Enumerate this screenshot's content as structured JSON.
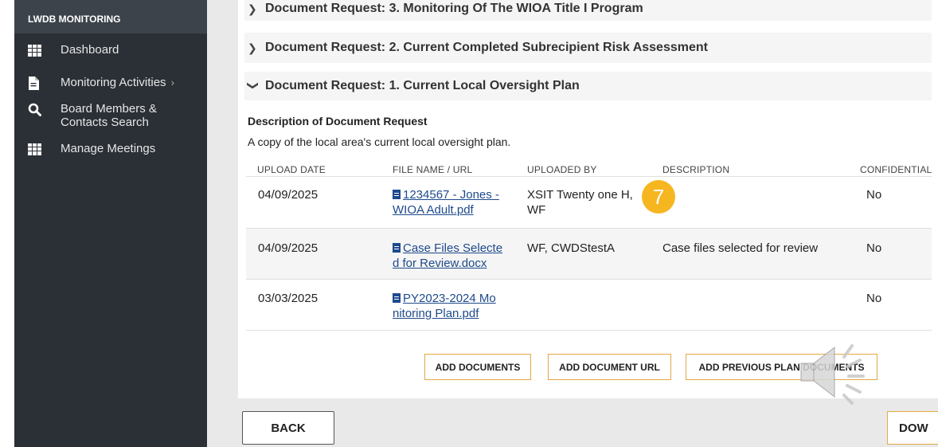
{
  "sidebar": {
    "title": "LWDB MONITORING",
    "items": [
      {
        "label": "Dashboard",
        "icon": "grid-icon"
      },
      {
        "label": "Monitoring Activities",
        "icon": "document-icon",
        "chevron": "›"
      },
      {
        "label": "Board Members & Contacts Search",
        "icon": "search-icon"
      },
      {
        "label": "Manage Meetings",
        "icon": "grid-icon"
      }
    ]
  },
  "accordion": {
    "items": [
      {
        "label": "Document Request: 3. Monitoring Of The WIOA Title I Program",
        "state": "collapsed"
      },
      {
        "label": "Document Request: 2. Current Completed Subrecipient Risk Assessment",
        "state": "collapsed"
      },
      {
        "label": "Document Request: 1. Current Local Oversight Plan",
        "state": "expanded"
      }
    ]
  },
  "request": {
    "desc_title": "Description of Document Request",
    "desc_text": "A copy of the local area's current local oversight plan."
  },
  "table": {
    "headers": [
      "UPLOAD DATE",
      "FILE NAME / URL",
      "UPLOADED BY",
      "DESCRIPTION",
      "CONFIDENTIAL"
    ],
    "rows": [
      {
        "date": "04/09/2025",
        "file_line1": "1234567 - Jones -",
        "file_line2": "WIOA Adult.pdf",
        "by_line1": "XSIT Twenty one H,",
        "by_line2": "WF",
        "description": "",
        "confidential": "No"
      },
      {
        "date": "04/09/2025",
        "file_line1": "Case Files Selecte",
        "file_line2": "d for Review.docx",
        "by_line1": "WF, CWDStestA",
        "by_line2": "",
        "description": "Case files selected for review",
        "confidential": "No"
      },
      {
        "date": "03/03/2025",
        "file_line1": "PY2023-2024 Mo",
        "file_line2": "nitoring Plan.pdf",
        "by_line1": "",
        "by_line2": "",
        "description": "",
        "confidential": "No"
      }
    ]
  },
  "actions": {
    "add_documents": "ADD DOCUMENTS",
    "add_document_url": "ADD DOCUMENT URL",
    "add_previous": "ADD PREVIOUS PLAN DOCUMENTS"
  },
  "footer": {
    "back": "BACK",
    "download": "DOW"
  },
  "step_badge": "7",
  "colors": {
    "sidebar_bg": "#2b3036",
    "sidebar_header_bg": "#3c434b",
    "link": "#1e4a8c",
    "button_border": "#e3a843",
    "badge": "#f6b620"
  }
}
